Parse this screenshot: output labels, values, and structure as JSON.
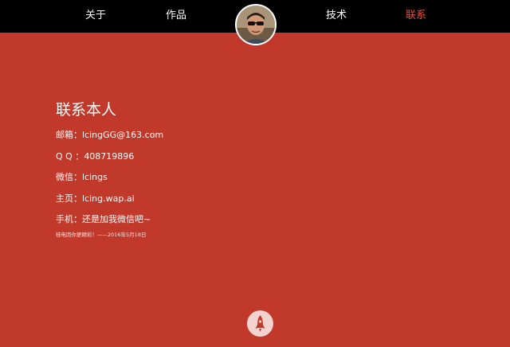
{
  "nav": {
    "items": [
      {
        "label": "关于"
      },
      {
        "label": "作品"
      },
      {
        "label": "技术"
      },
      {
        "label": "联系",
        "active": true
      }
    ]
  },
  "contact": {
    "heading": "联系本人",
    "rows": [
      {
        "label": "邮箱：",
        "value": "lcingGG@163.com"
      },
      {
        "label": "Q Q ：",
        "value": "408719896"
      },
      {
        "label": "微信：",
        "value": "lcings"
      },
      {
        "label": "主页：",
        "value": "lcing.wap.ai"
      },
      {
        "label": "手机：",
        "value": "还是加我微信吧~"
      }
    ],
    "footnote": "桂电因你更精彩！——2016年5月18日"
  },
  "icons": {
    "avatar": "profile-photo",
    "back_to_top": "rocket-icon"
  },
  "colors": {
    "background": "#c0392b",
    "topbar": "#000000",
    "active_nav": "#e74c3c",
    "rocket_button": "#f3d3cf"
  }
}
